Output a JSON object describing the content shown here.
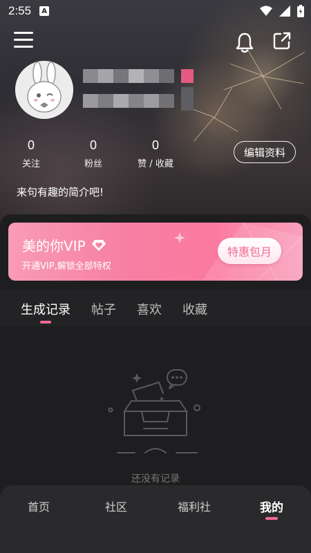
{
  "status_bar": {
    "time": "2:55",
    "notification_badge": "A"
  },
  "header": {
    "menu_icon": "hamburger-menu-icon",
    "bell_icon": "bell-icon",
    "share_icon": "share-external-icon"
  },
  "profile": {
    "avatar": "rabbit-avatar",
    "stats": [
      {
        "value": "0",
        "label": "关注"
      },
      {
        "value": "0",
        "label": "粉丝"
      },
      {
        "value": "0",
        "label": "赞 / 收藏"
      }
    ],
    "edit_label": "编辑资料",
    "bio": "来句有趣的简介吧!"
  },
  "vip": {
    "title": "美的你VIP",
    "subtitle": "开通VIP,解锁全部特权",
    "button": "特惠包月",
    "accent": "#f77fa3"
  },
  "tabs": [
    {
      "label": "生成记录",
      "active": true
    },
    {
      "label": "帖子",
      "active": false
    },
    {
      "label": "喜欢",
      "active": false
    },
    {
      "label": "收藏",
      "active": false
    }
  ],
  "empty_state": {
    "text": "还没有记录",
    "icon": "empty-inbox-icon"
  },
  "bottom_nav": [
    {
      "label": "首页",
      "active": false
    },
    {
      "label": "社区",
      "active": false
    },
    {
      "label": "福利社",
      "active": false
    },
    {
      "label": "我的",
      "active": true
    }
  ],
  "colors": {
    "accent_pink": "#f06a92",
    "panel_bg": "#1e1e20"
  }
}
